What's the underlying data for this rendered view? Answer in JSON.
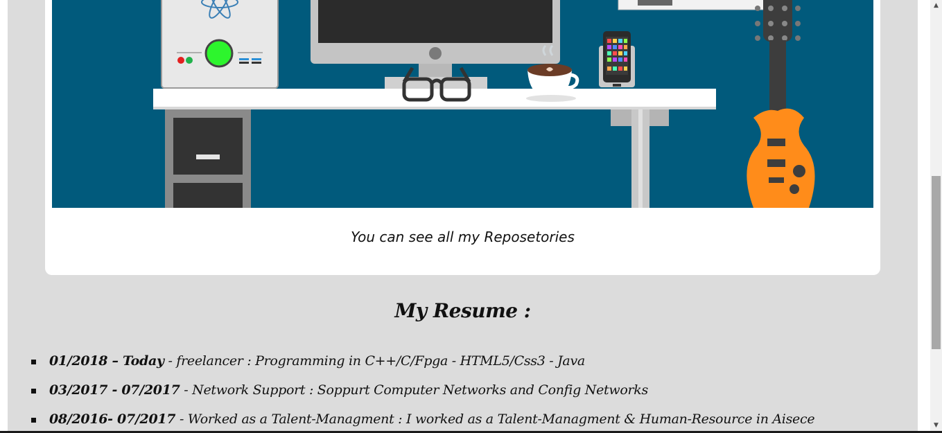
{
  "colors": {
    "page_background": "#dcdcdc",
    "card_background": "#ffffff",
    "banner_background": "#015a7c",
    "text": "#111111"
  },
  "banner": {
    "icons": [
      "computer-tower-icon",
      "react-logo-icon",
      "power-button-icon",
      "monitor-icon",
      "glasses-icon",
      "coffee-cup-icon",
      "smartphone-icon",
      "guitar-icon",
      "desk-icon",
      "drawer-cabinet-icon"
    ]
  },
  "card": {
    "caption": "You can see all my Reposetories"
  },
  "resume": {
    "title": "My Resume :",
    "items": [
      {
        "date": "01/2018 – Today",
        "text": " - freelancer : Programming in C++/C/Fpga - HTML5/Css3 - Java"
      },
      {
        "date": "03/2017 - 07/2017",
        "text": " - Network Support : Soppurt Computer Networks and Config Networks"
      },
      {
        "date": "08/2016- 07/2017",
        "text": " - Worked as a Talent-Managment : I worked as a Talent-Managment & Human-Resource in Aisece"
      }
    ]
  },
  "scrollbar": {
    "up_arrow": "▲",
    "down_arrow": "▼"
  }
}
